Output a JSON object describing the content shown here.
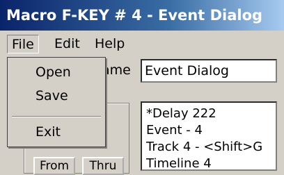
{
  "window": {
    "title": "Macro F-KEY # 4 - Event Dialog"
  },
  "menubar": {
    "file": "File",
    "edit": "Edit",
    "help": "Help"
  },
  "file_menu": {
    "open": "Open",
    "save": "Save",
    "exit": "Exit"
  },
  "form": {
    "name_label_partial": "ame",
    "name_value": "Event Dialog"
  },
  "buttons": {
    "from": "From",
    "thru": "Thru"
  },
  "events": [
    "*Delay 222",
    "Event - 4",
    "Track 4 - <Shift>G",
    "Timeline 4"
  ]
}
